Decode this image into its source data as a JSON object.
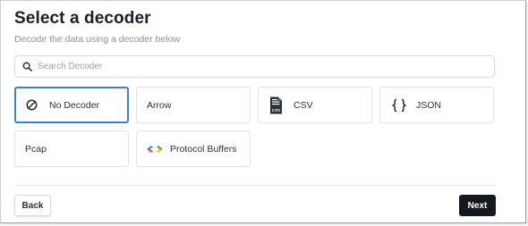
{
  "header": {
    "title": "Select a decoder",
    "subtitle": "Decode the data using a decoder below"
  },
  "search": {
    "placeholder": "Search Decoder",
    "value": ""
  },
  "decoders": [
    {
      "label": "No Decoder",
      "icon": "no-decoder-icon",
      "selected": true
    },
    {
      "label": "Arrow",
      "icon": "",
      "selected": false
    },
    {
      "label": "CSV",
      "icon": "csv-file-icon",
      "selected": false
    },
    {
      "label": "JSON",
      "icon": "curly-braces-icon",
      "selected": false
    },
    {
      "label": "Pcap",
      "icon": "",
      "selected": false
    },
    {
      "label": "Protocol Buffers",
      "icon": "protocol-buffers-icon",
      "selected": false
    }
  ],
  "csv_icon_text": "CSV",
  "footer": {
    "back_label": "Back",
    "next_label": "Next"
  },
  "colors": {
    "accent": "#3b7ddd",
    "primary_button": "#15191f"
  }
}
